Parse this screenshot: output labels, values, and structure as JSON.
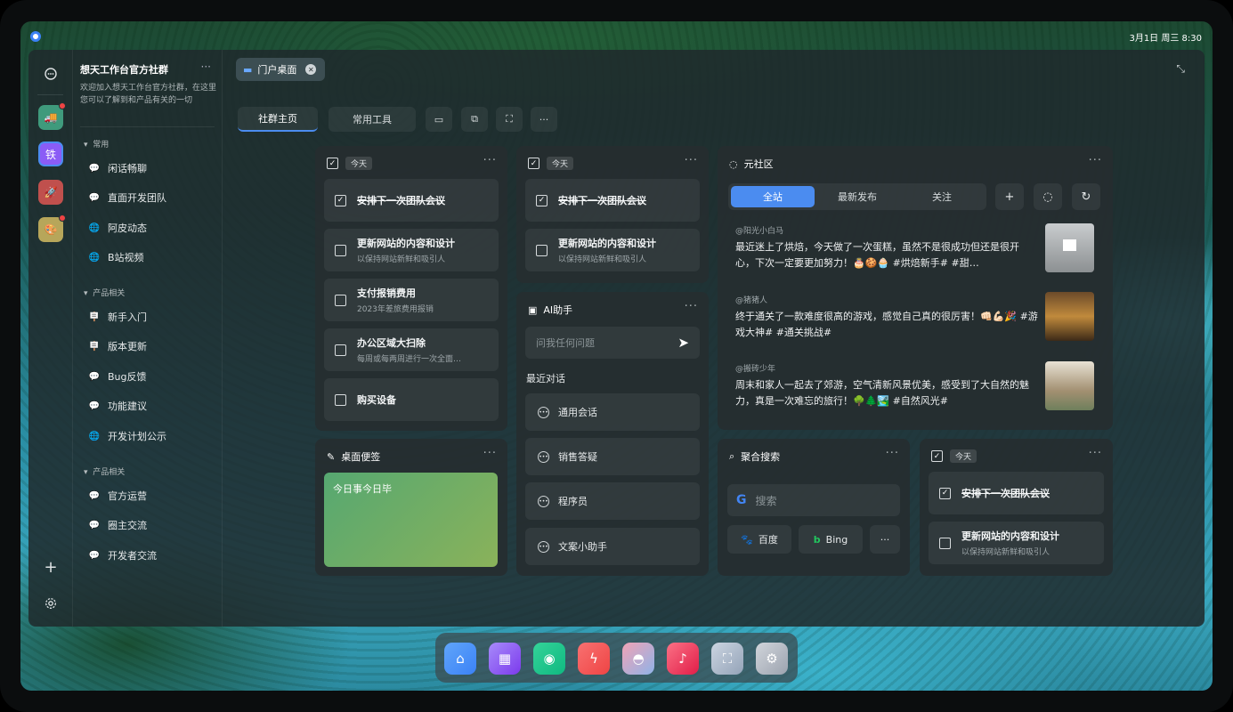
{
  "status_bar": {
    "clock": "3月1日 周三 8:30"
  },
  "rail": {
    "items": [
      {
        "name": "chat",
        "label": ""
      },
      {
        "name": "app-1",
        "label": ""
      },
      {
        "name": "app-tie",
        "label": "铁"
      },
      {
        "name": "app-3",
        "label": ""
      },
      {
        "name": "app-4",
        "label": ""
      }
    ]
  },
  "sidebar": {
    "title": "想天工作台官方社群",
    "more": "···",
    "description": "欢迎加入想天工作台官方社群，在这里您可以了解到和产品有关的一切",
    "sections": [
      {
        "label": "常用",
        "items": [
          "闲话畅聊",
          "直面开发团队",
          "阿皮动态",
          "B站视频"
        ]
      },
      {
        "label": "产品相关",
        "items": [
          "新手入门",
          "版本更新",
          "Bug反馈",
          "功能建议",
          "开发计划公示"
        ]
      },
      {
        "label": "产品相关",
        "items": [
          "官方运营",
          "圈主交流",
          "开发者交流"
        ]
      }
    ]
  },
  "main": {
    "tab_label": "门户桌面",
    "segments": [
      "社群主页",
      "常用工具"
    ]
  },
  "todo1": {
    "today": "今天",
    "items": [
      {
        "title": "安排下一次团队会议",
        "sub": "",
        "done": true
      },
      {
        "title": "更新网站的内容和设计",
        "sub": "以保持网站新鲜和吸引人",
        "done": false
      },
      {
        "title": "支付报销费用",
        "sub": "2023年差旅费用报销",
        "done": false
      },
      {
        "title": "办公区域大扫除",
        "sub": "每周或每两周进行一次全面…",
        "done": false
      },
      {
        "title": "购买设备",
        "sub": "",
        "done": false
      }
    ]
  },
  "todo2": {
    "today": "今天",
    "items": [
      {
        "title": "安排下一次团队会议",
        "sub": "",
        "done": true
      },
      {
        "title": "更新网站的内容和设计",
        "sub": "以保持网站新鲜和吸引人",
        "done": false
      }
    ]
  },
  "todo3": {
    "today": "今天",
    "items": [
      {
        "title": "安排下一次团队会议",
        "sub": "",
        "done": true
      },
      {
        "title": "更新网站的内容和设计",
        "sub": "以保持网站新鲜和吸引人",
        "done": false
      }
    ]
  },
  "note": {
    "title": "桌面便签",
    "content": "今日事今日毕"
  },
  "ai": {
    "title": "AI助手",
    "placeholder": "问我任何问题",
    "recent_label": "最近对话",
    "conversations": [
      "通用会话",
      "销售答疑",
      "程序员",
      "文案小助手"
    ]
  },
  "community": {
    "title": "元社区",
    "tabs": [
      "全站",
      "最新发布",
      "关注"
    ],
    "posts": [
      {
        "author": "@阳光小白马",
        "text": "最近迷上了烘焙，今天做了一次蛋糕，虽然不是很成功但还是很开心，下次一定要更加努力！🎂🍪🧁 #烘焙新手# #甜…"
      },
      {
        "author": "@猪猪人",
        "text": "终于通关了一款难度很高的游戏，感觉自己真的很厉害！👊🏻💪🏻🎉 #游戏大神# #通关挑战#"
      },
      {
        "author": "@搬砖少年",
        "text": "周末和家人一起去了郊游，空气清新风景优美，感受到了大自然的魅力，真是一次难忘的旅行！🌳🌲🏞️ #自然风光#"
      }
    ]
  },
  "search": {
    "title": "聚合搜索",
    "placeholder": "搜索",
    "engines": [
      "百度",
      "Bing"
    ]
  },
  "dock": {
    "apps": [
      "home",
      "apps",
      "chat",
      "flash",
      "game",
      "music",
      "screenshot",
      "settings"
    ]
  },
  "colors": {
    "accent": "#4b8cf0",
    "badge": "#ef4444",
    "note_start": "#56a871",
    "note_end": "#8ab25a"
  }
}
